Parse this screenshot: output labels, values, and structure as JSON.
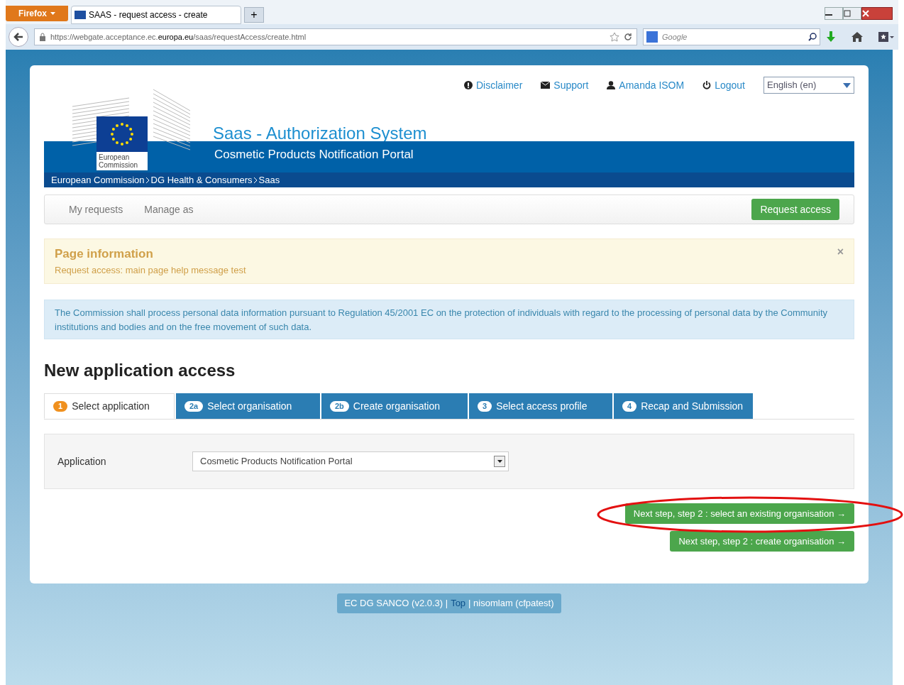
{
  "browser": {
    "menu_button": "Firefox",
    "tab_title": "SAAS - request access - create",
    "new_tab": "+",
    "url_prefix": "https://webgate.acceptance.ec.",
    "url_domain": "europa.eu",
    "url_path": "/saas/requestAccess/create.html",
    "search_placeholder": "Google"
  },
  "header": {
    "logo_text": "European Commission",
    "title": "Saas - Authorization System",
    "subtitle": "Cosmetic Products Notification Portal",
    "top_links": [
      {
        "kind": "info",
        "label": "Disclaimer"
      },
      {
        "kind": "mail",
        "label": "Support"
      },
      {
        "kind": "user",
        "label": "Amanda ISOM"
      },
      {
        "kind": "power",
        "label": "Logout"
      }
    ],
    "language": "English (en)",
    "breadcrumb": [
      "European Commission",
      "DG Health & Consumers",
      "Saas"
    ]
  },
  "navbar": {
    "items": [
      "My requests",
      "Manage as"
    ],
    "action": "Request access"
  },
  "page_info": {
    "title": "Page information",
    "text": "Request access: main page help message test",
    "close": "×"
  },
  "notice": "The Commission shall process personal data information pursuant to Regulation 45/2001 EC on the protection of individuals with regard to the processing of personal data by the Community institutions and bodies and on the free movement of such data.",
  "heading": "New application access",
  "steps": [
    {
      "badge": "1",
      "label": "Select application",
      "selected": true
    },
    {
      "badge": "2a",
      "label": "Select organisation",
      "selected": false
    },
    {
      "badge": "2b",
      "label": "Create organisation",
      "selected": false
    },
    {
      "badge": "3",
      "label": "Select access profile",
      "selected": false
    },
    {
      "badge": "4",
      "label": "Recap and Submission",
      "selected": false
    }
  ],
  "form": {
    "label": "Application",
    "value": "Cosmetic Products Notification Portal"
  },
  "buttons": [
    "Next step, step 2 : select an existing organisation →",
    "Next step, step 2 : create organisation →"
  ],
  "footer": {
    "version": "EC DG SANCO (v2.0.3) |",
    "link": "Top",
    "user": "| nisomlam (cfpatest)"
  }
}
